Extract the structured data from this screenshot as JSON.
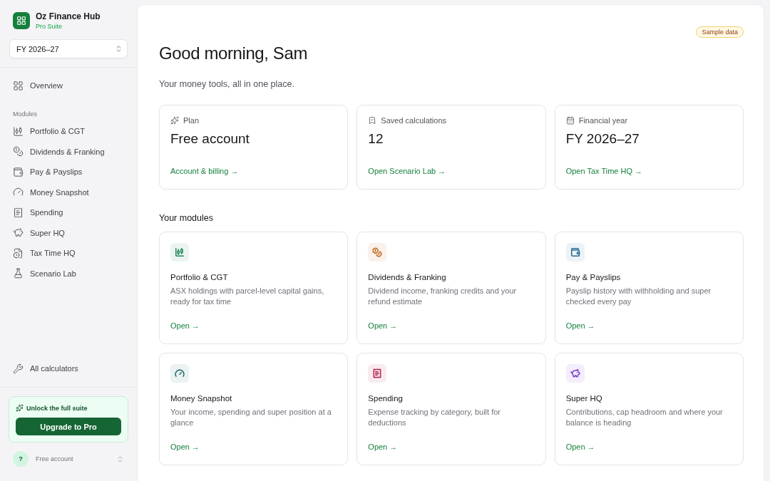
{
  "sidebar": {
    "brand": {
      "name": "Oz Finance Hub",
      "tier": "Pro Suite"
    },
    "year_select": {
      "value": "FY 2026–27"
    },
    "overview": {
      "label": "Overview",
      "selected": false
    },
    "section_label": "Modules",
    "items": [
      {
        "label": "Portfolio & CGT",
        "selected": false
      },
      {
        "label": "Dividends & Franking",
        "selected": false
      },
      {
        "label": "Pay & Payslips",
        "selected": false
      },
      {
        "label": "Money Snapshot",
        "selected": false
      },
      {
        "label": "Spending",
        "selected": false
      },
      {
        "label": "Super HQ",
        "selected": false
      },
      {
        "label": "Tax Time HQ",
        "selected": false
      },
      {
        "label": "Scenario Lab",
        "selected": false
      }
    ],
    "all_calculators": "All calculators",
    "promo": {
      "title": "Unlock the full suite",
      "button": "Upgrade to Pro"
    },
    "account": {
      "avatar": "?",
      "label": "Free account"
    }
  },
  "main": {
    "badge": "Sample data",
    "greeting": "Good morning, Sam",
    "subtitle": "Your money tools, all in one place.",
    "stats": [
      {
        "label": "Plan",
        "value": "Free account",
        "link": "Account & billing →"
      },
      {
        "label": "Saved calculations",
        "value": "12",
        "link": "Open Scenario Lab →"
      },
      {
        "label": "Financial year",
        "value": "FY 2026–27",
        "link": "Open Tax Time HQ →"
      }
    ],
    "modules_heading": "Your modules",
    "modules": [
      {
        "color": "#1f8a5b",
        "title": "Portfolio & CGT",
        "description": "ASX holdings with parcel-level capital gains, ready for tax time",
        "link": "Open →"
      },
      {
        "color": "#c2681c",
        "title": "Dividends & Franking",
        "description": "Dividend income, franking credits and your refund estimate",
        "link": "Open →"
      },
      {
        "color": "#2a6f97",
        "title": "Pay & Payslips",
        "description": "Payslip history with withholding and super checked every pay",
        "link": "Open →"
      },
      {
        "color": "#1f6f6a",
        "title": "Money Snapshot",
        "description": "Your income, spending and super position at a glance",
        "link": "Open →"
      },
      {
        "color": "#b3264f",
        "title": "Spending",
        "description": "Expense tracking by category, built for deductions",
        "link": "Open →"
      },
      {
        "color": "#7a3fd1",
        "title": "Super HQ",
        "description": "Contributions, cap headroom and where your balance is heading",
        "link": "Open →"
      }
    ]
  }
}
